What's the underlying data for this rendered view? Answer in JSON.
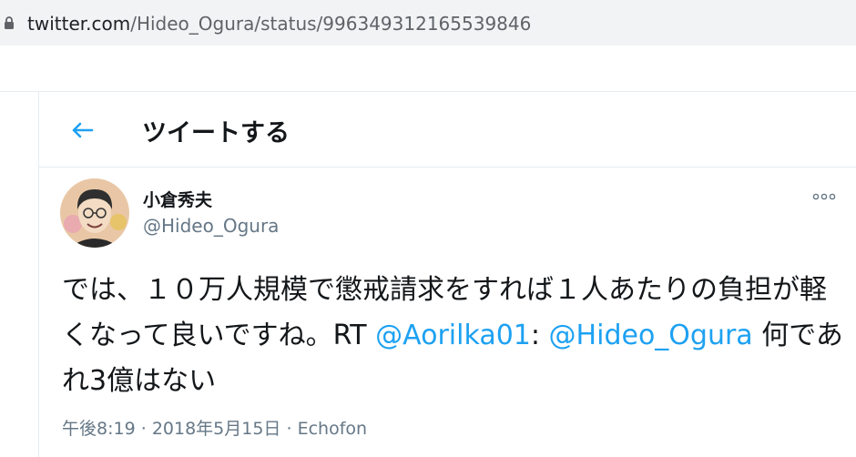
{
  "browser": {
    "url_domain": "twitter.com",
    "url_path": "/Hideo_Ogura/status/996349312165539846",
    "lock_icon": "lock-icon"
  },
  "header": {
    "back_icon": "arrow-left-icon",
    "title": "ツイートする"
  },
  "tweet": {
    "author_name": "小倉秀夫",
    "author_handle": "@Hideo_Ogura",
    "more_icon": "more-dots-icon",
    "text_part1": "では、１０万人規模で懲戒請求をすれば１人あたりの負担が軽くなって良いですね。RT ",
    "mention_1": "@Aorilka01",
    "text_part2": ": ",
    "mention_2": "@Hideo_Ogura",
    "text_part3": " 何であれ3億はない",
    "time": "午後8:19",
    "separator": "·",
    "date": "2018年5月15日",
    "source": "Echofon"
  },
  "colors": {
    "accent": "#1da1f2",
    "text_primary": "#14171a",
    "text_secondary": "#657786",
    "border": "#e6ecf0"
  }
}
